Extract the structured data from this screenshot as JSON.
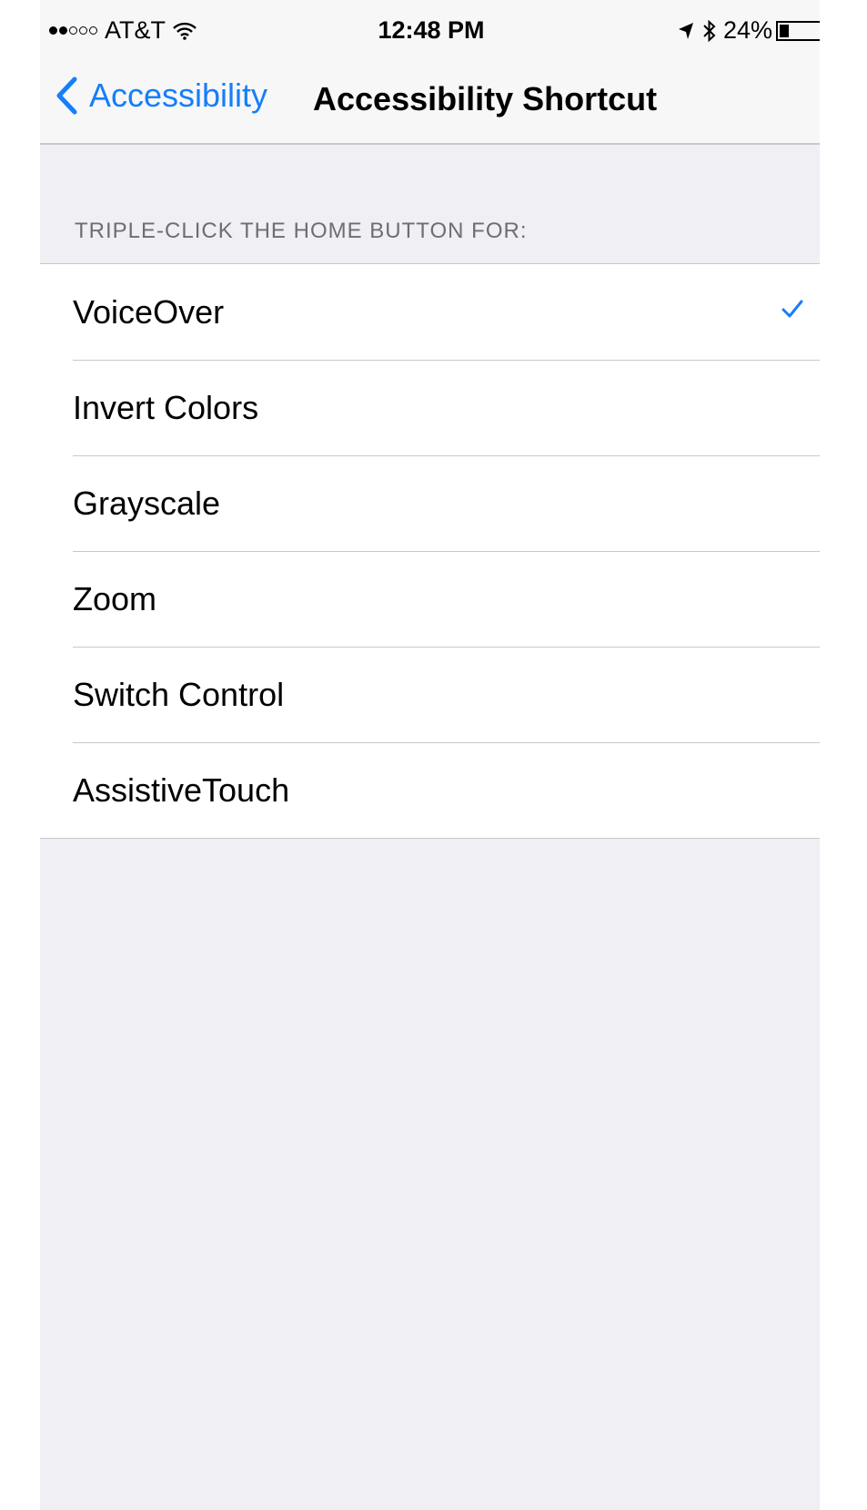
{
  "status_bar": {
    "carrier": "AT&T",
    "signal_bars_filled": 2,
    "signal_bars_total": 5,
    "time": "12:48 PM",
    "battery_percent": "24%",
    "battery_level": 0.24
  },
  "nav": {
    "back_label": "Accessibility",
    "title": "Accessibility Shortcut"
  },
  "section": {
    "header": "TRIPLE-CLICK THE HOME BUTTON FOR:"
  },
  "options": [
    {
      "label": "VoiceOver",
      "checked": true
    },
    {
      "label": "Invert Colors",
      "checked": false
    },
    {
      "label": "Grayscale",
      "checked": false
    },
    {
      "label": "Zoom",
      "checked": false
    },
    {
      "label": "Switch Control",
      "checked": false
    },
    {
      "label": "AssistiveTouch",
      "checked": false
    }
  ],
  "colors": {
    "accent": "#157efb",
    "background": "#efeff4",
    "separator": "#c8c7cc",
    "header_text": "#6d6d72"
  }
}
